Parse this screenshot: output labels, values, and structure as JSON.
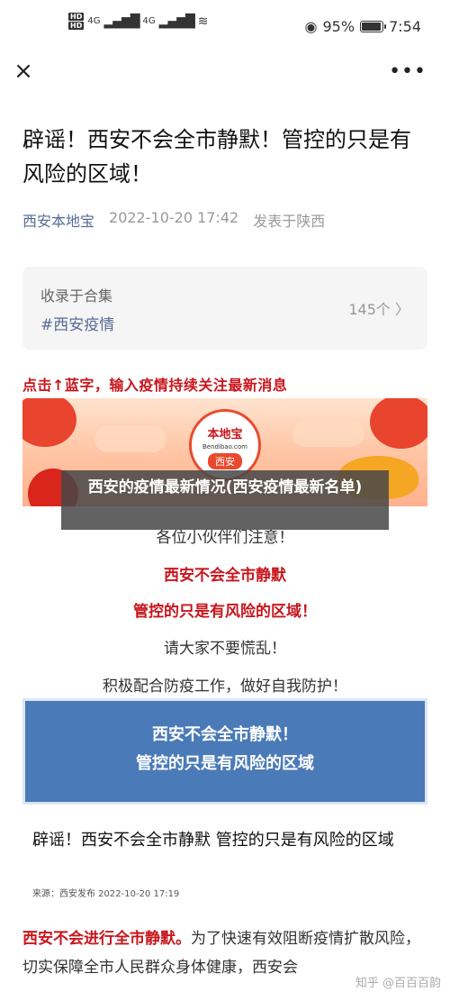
{
  "status_bar": {
    "hd1": "HD",
    "hd2": "HD",
    "network1": "4G",
    "network2": "4G",
    "battery_percent_text": "95%",
    "battery_level": 0.95,
    "time": "7:54"
  },
  "nav": {
    "close_icon": "close-icon",
    "more_icon": "more-icon",
    "close_glyph": "×",
    "more_glyph": "•••"
  },
  "article": {
    "title": "辟谣！西安不会全市静默！管控的只是有风险的区域！",
    "author": "西安本地宝",
    "datetime": "2022-10-20 17:42",
    "location": "发表于陕西"
  },
  "collection": {
    "label": "收录于合集",
    "tag": "#西安疫情",
    "count": "145个 〉"
  },
  "cta": "点击↑蓝字，输入疫情持续关注最新消息",
  "banner": {
    "logo_title": "本地宝",
    "logo_domain": "Bendibao.com",
    "logo_city": "西安"
  },
  "overlay_caption": "西安的疫情最新情况(西安疫情最新名单)",
  "paragraphs": {
    "p1": "各位小伙伴们注意！",
    "p2": "西安不会全市静默",
    "p3": "管控的只是有风险的区域！",
    "p4": "请大家不要慌乱！",
    "p5": "积极配合防疫工作，做好自我防护！"
  },
  "blue_box": {
    "line1": "西安不会全市静默！",
    "line2": "管控的只是有风险的区域"
  },
  "card": {
    "title": "辟谣！西安不会全市静默 管控的只是有风险的区域",
    "source": "来源：西安发布 2022-10-20 17:19"
  },
  "body": {
    "lead": "西安不会进行全市静默。",
    "text": "为了快速有效阻断疫情扩散风险，切实保障全市人民群众身体健康，西安会"
  },
  "watermark": "知乎 @百百百韵",
  "colors": {
    "accent_red": "#c8161d",
    "link_blue": "#576b95",
    "box_blue": "#4a7ab8"
  }
}
